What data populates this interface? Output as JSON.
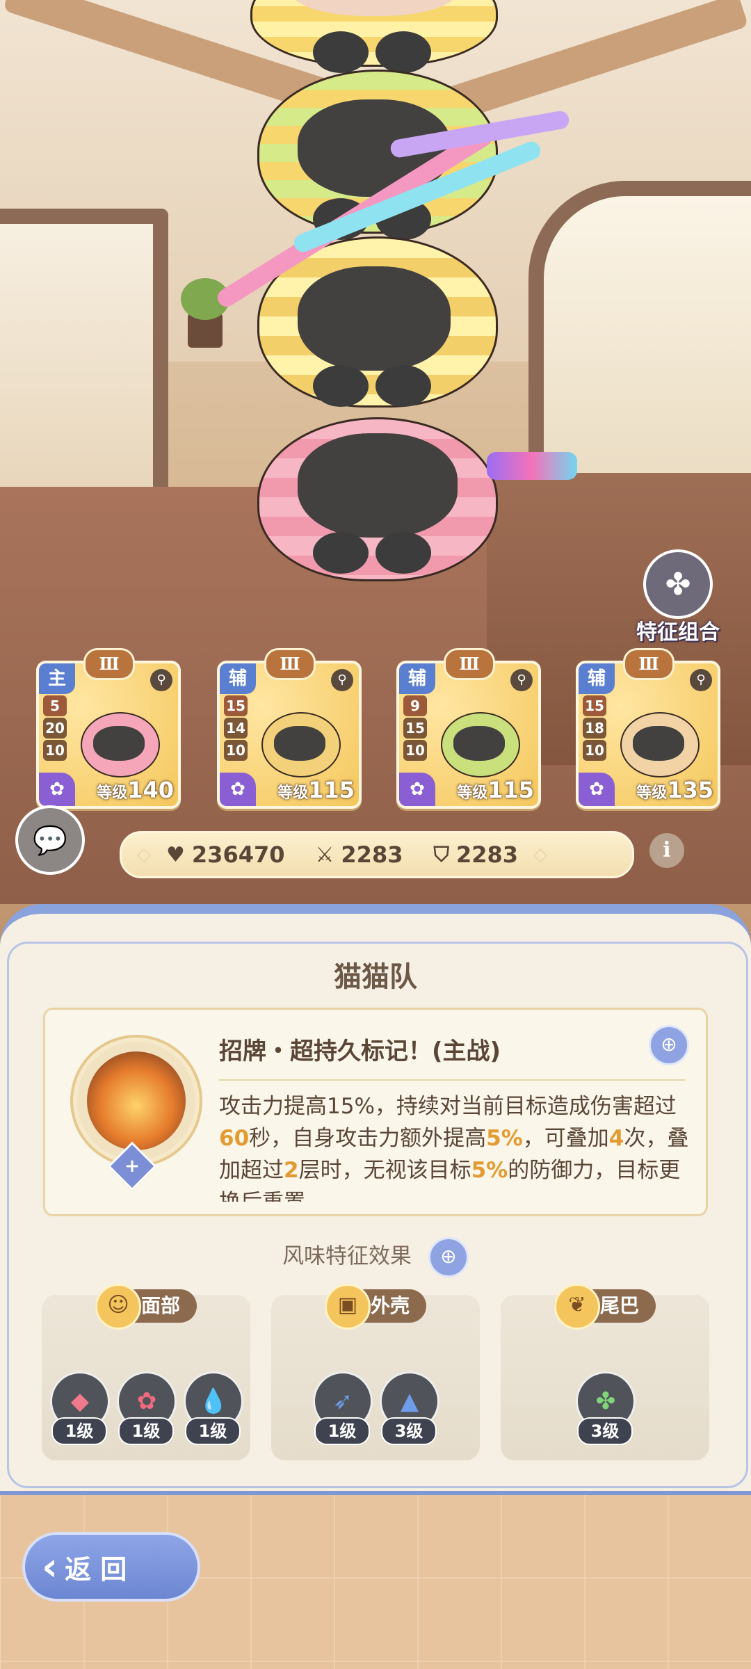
{
  "feature_combo": {
    "label": "特征组合",
    "icon": "flower-icon"
  },
  "cards": [
    {
      "role": "主",
      "rank": "Ⅲ",
      "stats": [
        "5",
        "20",
        "10"
      ],
      "level_label": "等级",
      "level": "140",
      "body_color": "#f5a6b9"
    },
    {
      "role": "辅",
      "rank": "Ⅲ",
      "stats": [
        "15",
        "14",
        "10"
      ],
      "level_label": "等级",
      "level": "115",
      "body_color": "#f3d07a"
    },
    {
      "role": "辅",
      "rank": "Ⅲ",
      "stats": [
        "9",
        "15",
        "10"
      ],
      "level_label": "等级",
      "level": "115",
      "body_color": "#c9e07d"
    },
    {
      "role": "辅",
      "rank": "Ⅲ",
      "stats": [
        "15",
        "18",
        "10"
      ],
      "level_label": "等级",
      "level": "135",
      "body_color": "#f2d3a6"
    }
  ],
  "stats_bar": {
    "hp": "236470",
    "attack": "2283",
    "defense": "2283"
  },
  "panel": {
    "title": "猫猫队",
    "skill": {
      "name": "招牌・超持久标记！(主战)",
      "badge": "+",
      "desc_parts": [
        {
          "t": "攻击力提高15%，持续对当前目标造成伤害超过"
        },
        {
          "t": "60",
          "hl": true
        },
        {
          "t": "秒，自身攻击力额外提高"
        },
        {
          "t": "5%",
          "hl": true
        },
        {
          "t": "，可叠加"
        },
        {
          "t": "4",
          "hl": true
        },
        {
          "t": "次，叠加超过"
        },
        {
          "t": "2",
          "hl": true
        },
        {
          "t": "层时，无视该目标"
        },
        {
          "t": "5%",
          "hl": true
        },
        {
          "t": "的防御力，目标更换后重置"
        }
      ]
    },
    "flavor_title": "风味特征效果",
    "parts": [
      {
        "label": "面部",
        "icon": "face-icon",
        "traits": [
          {
            "icon": "diamond-icon",
            "level": "1级",
            "color": "#f07a8c"
          },
          {
            "icon": "flower-icon",
            "level": "1级",
            "color": "#f06a7e"
          },
          {
            "icon": "drop-icon",
            "level": "1级",
            "color": "#f25b6a"
          }
        ]
      },
      {
        "label": "外壳",
        "icon": "shell-icon",
        "traits": [
          {
            "icon": "feather-icon",
            "level": "1级",
            "color": "#6f9ce8"
          },
          {
            "icon": "prism-icon",
            "level": "3级",
            "color": "#6f9ce8"
          }
        ]
      },
      {
        "label": "尾巴",
        "icon": "tail-icon",
        "traits": [
          {
            "icon": "paw-icon",
            "level": "3级",
            "color": "#7fd47a"
          }
        ]
      }
    ]
  },
  "back_button": {
    "label": "返 回"
  }
}
